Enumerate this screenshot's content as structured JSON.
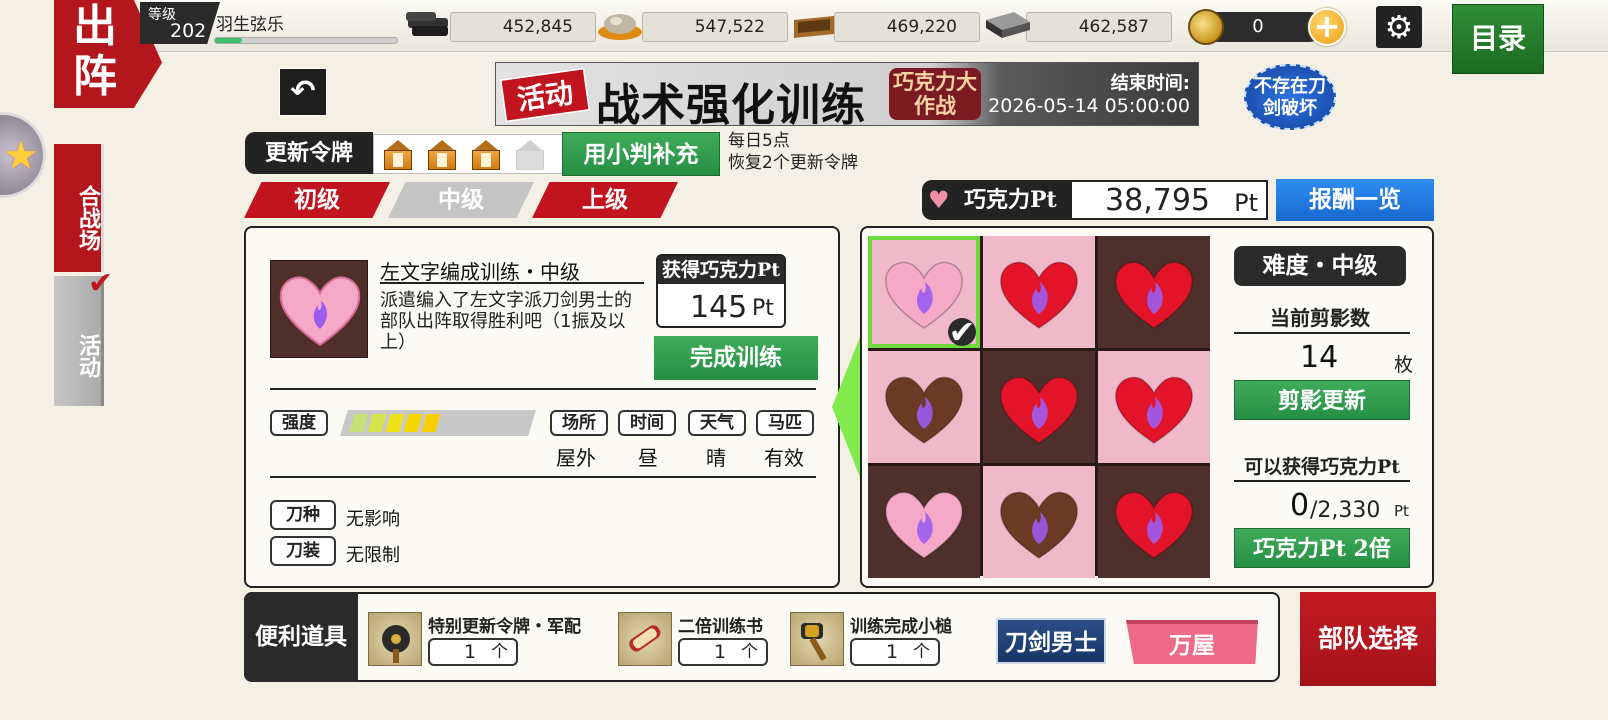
{
  "header": {
    "sortie_tag": "出阵",
    "level_label": "等级",
    "level": "202",
    "player_name": "羽生弦乐",
    "exp_progress": 0.15,
    "resources": [
      {
        "icon": "charcoal-icon",
        "value": "452,845"
      },
      {
        "icon": "tamahagane-icon",
        "value": "547,522"
      },
      {
        "icon": "cooling-material-icon",
        "value": "469,220"
      },
      {
        "icon": "whetstone-icon",
        "value": "462,587"
      }
    ],
    "koban": "0",
    "menu_label": "目录"
  },
  "side_tabs": {
    "battle_arena": "合战场",
    "event": "活动"
  },
  "banner": {
    "tag": "活动",
    "title": "战术强化训练",
    "subtitle": "巧克力大作战",
    "end_label": "结束时间:",
    "end_time": "2026-05-14 05:00:00"
  },
  "no_break_badge": "不存在刀剑破坏",
  "tokens": {
    "label": "更新令牌",
    "filled": 3,
    "total": 4,
    "refill_label": "用小判补充",
    "note_line1": "每日5点",
    "note_line2": "恢复2个更新令牌"
  },
  "difficulty_tabs": [
    {
      "label": "初级",
      "state": "red"
    },
    {
      "label": "中级",
      "state": "gray"
    },
    {
      "label": "上级",
      "state": "red"
    }
  ],
  "choco_pt": {
    "label": "巧克力Pt",
    "value": "38,795",
    "unit": "Pt",
    "reward_label": "报酬一览"
  },
  "mission": {
    "title": "左文字编成训练・中级",
    "description": "派遣编入了左文字派刀剑男士的部队出阵取得胜利吧（1振及以上）",
    "gain_label": "获得巧克力Pt",
    "gain_value": "145",
    "gain_unit": "Pt",
    "complete_label": "完成训练",
    "strength_label": "强度",
    "strength_level": 5,
    "conditions": [
      {
        "label": "场所",
        "value": "屋外"
      },
      {
        "label": "时间",
        "value": "昼"
      },
      {
        "label": "天气",
        "value": "晴"
      },
      {
        "label": "马匹",
        "value": "有效"
      }
    ],
    "sword_type_label": "刀种",
    "sword_type_value": "无影响",
    "equipment_label": "刀装",
    "equipment_value": "无限制"
  },
  "grid": {
    "cells": [
      {
        "bg": "pink",
        "heart": "pink",
        "selected": true
      },
      {
        "bg": "pink",
        "heart": "red",
        "selected": false
      },
      {
        "bg": "brown",
        "heart": "red",
        "selected": false
      },
      {
        "bg": "pink",
        "heart": "brown",
        "selected": false
      },
      {
        "bg": "brown",
        "heart": "red",
        "selected": false
      },
      {
        "bg": "pink",
        "heart": "red",
        "selected": false
      },
      {
        "bg": "brown",
        "heart": "pink",
        "selected": false
      },
      {
        "bg": "pink",
        "heart": "brown",
        "selected": false
      },
      {
        "bg": "brown",
        "heart": "red",
        "selected": false
      }
    ],
    "colors": {
      "pink_heart": "#f5a9c6",
      "red_heart": "#e3142a",
      "brown_heart": "#6a3a24",
      "flame": "#9b5cf0"
    }
  },
  "difficulty_side": {
    "label": "难度・中级",
    "silhouette_label": "当前剪影数",
    "silhouette_value": "14",
    "silhouette_unit": "枚",
    "refresh_label": "剪影更新",
    "obtainable_label": "可以获得巧克力Pt",
    "obtainable_value": "0",
    "obtainable_max": "/2,330",
    "obtainable_unit": "Pt",
    "double_label": "巧克力Pt 2倍"
  },
  "items": {
    "label": "便利道具",
    "list": [
      {
        "name": "特别更新令牌・军配",
        "count": "1",
        "unit": "个",
        "icon": "war-fan-token-icon"
      },
      {
        "name": "二倍训练书",
        "count": "1",
        "unit": "个",
        "icon": "scroll-icon"
      },
      {
        "name": "训练完成小槌",
        "count": "1",
        "unit": "个",
        "icon": "mallet-icon"
      }
    ]
  },
  "buttons": {
    "touken_danshi": "刀剑男士",
    "yorozuya": "万屋",
    "squad_select": "部队选择"
  }
}
